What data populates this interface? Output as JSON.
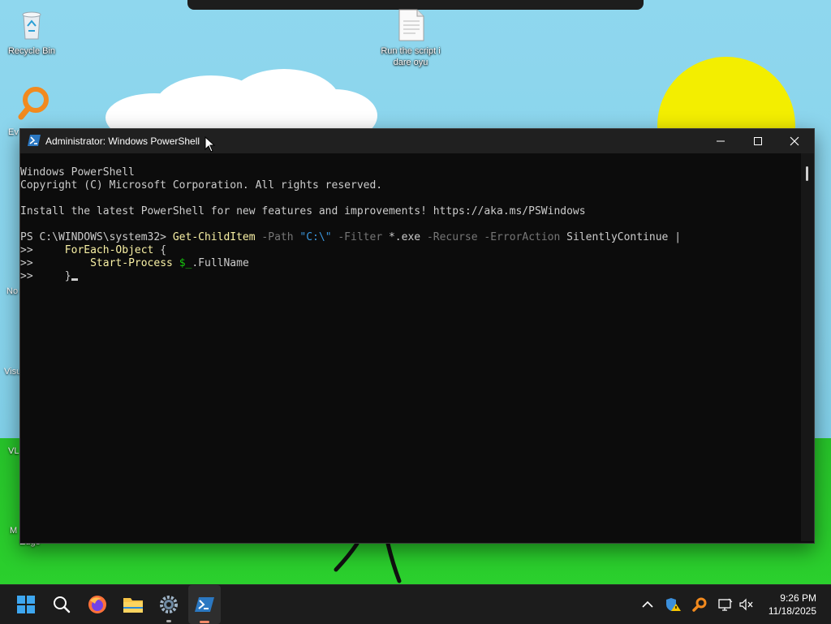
{
  "desktop": {
    "icons": [
      {
        "label": "Recycle Bin"
      },
      {
        "label": "Run the script i dare oyu"
      }
    ],
    "partial_labels": [
      "Ev",
      "No",
      "Visu",
      "VL",
      "M",
      "Edge"
    ]
  },
  "window": {
    "title": "Administrator: Windows PowerShell",
    "controls": {
      "minimize": "—",
      "maximize": "□",
      "close": "✕"
    }
  },
  "terminal": {
    "header1": "Windows PowerShell",
    "header2": "Copyright (C) Microsoft Corporation. All rights reserved.",
    "header3": "Install the latest PowerShell for new features and improvements! https://aka.ms/PSWindows",
    "prompt": "PS C:\\WINDOWS\\system32> ",
    "cmd1": "Get-ChildItem",
    "p_path": "-Path",
    "v_path": "\"C:\\\"",
    "p_filter": "-Filter",
    "v_filter": "*.exe",
    "p_recurse": "-Recurse",
    "p_erroraction": "-ErrorAction",
    "v_erroraction": "SilentlyContinue",
    "pipe": "|",
    "cont": ">>",
    "foreach": "ForEach-Object",
    "open_brace": "{",
    "start_process": "Start-Process",
    "var": "$_",
    "member": ".FullName",
    "close_brace": "}"
  },
  "taskbar": {
    "items": [
      "start-icon",
      "search-icon",
      "firefox-icon",
      "file-explorer-icon",
      "settings-icon",
      "powershell-icon"
    ],
    "tray": [
      "chevron-up-icon",
      "security-warning-icon",
      "search-tool-icon",
      "network-icon",
      "volume-muted-icon"
    ],
    "time": "9:26 PM",
    "date": "11/18/2025"
  },
  "colors": {
    "terminal_bg": "#0c0c0c",
    "cmd": "#f9f1a5",
    "param": "#767676",
    "string": "#3a96dd",
    "variable": "#16c60c"
  }
}
